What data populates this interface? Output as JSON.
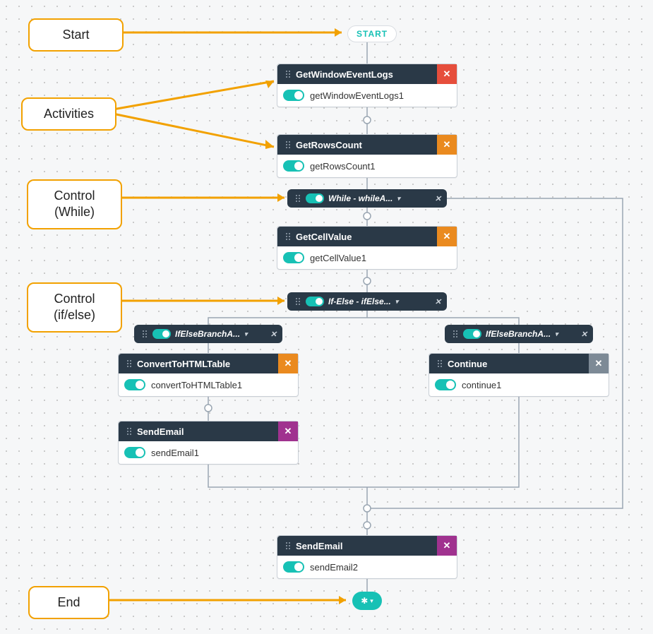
{
  "callouts": {
    "start": "Start",
    "activities": "Activities",
    "while": "Control\n(While)",
    "ifelse": "Control\n(if/else)",
    "end": "End"
  },
  "start_label": "START",
  "nodes": {
    "getWindowEventLogs": {
      "title": "GetWindowEventLogs",
      "instance": "getWindowEventLogs1"
    },
    "getRowsCount": {
      "title": "GetRowsCount",
      "instance": "getRowsCount1"
    },
    "while": {
      "label": "While - whileA..."
    },
    "getCellValue": {
      "title": "GetCellValue",
      "instance": "getCellValue1"
    },
    "ifelse": {
      "label": "If-Else - ifElse..."
    },
    "branchLeft": {
      "label": "IfElseBranchA..."
    },
    "branchRight": {
      "label": "IfElseBranchA..."
    },
    "convert": {
      "title": "ConvertToHTMLTable",
      "instance": "convertToHTMLTable1"
    },
    "continue": {
      "title": "Continue",
      "instance": "continue1"
    },
    "sendEmail1": {
      "title": "SendEmail",
      "instance": "sendEmail1"
    },
    "sendEmail2": {
      "title": "SendEmail",
      "instance": "sendEmail2"
    }
  },
  "colors": {
    "accent": "#17c1b5",
    "header": "#2a3947",
    "orange": "#ea8a1f",
    "purple": "#a0328f",
    "red": "#e64e3c",
    "grey": "#7d8a96",
    "callout": "#f2a100"
  }
}
